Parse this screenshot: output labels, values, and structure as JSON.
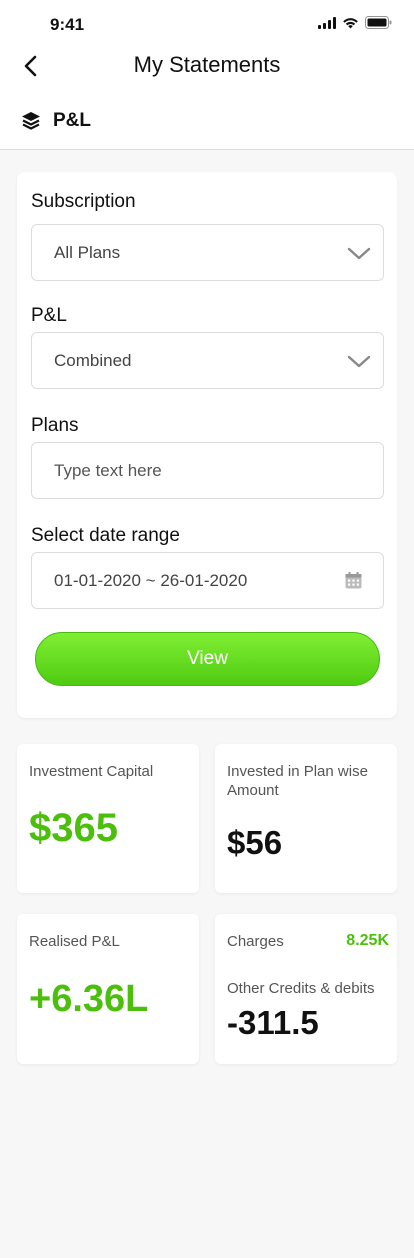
{
  "status_bar": {
    "time": "9:41"
  },
  "nav": {
    "title": "My Statements"
  },
  "section": {
    "title": "P&L"
  },
  "form": {
    "subscription": {
      "label": "Subscription",
      "value": "All Plans"
    },
    "pnl": {
      "label": "P&L",
      "value": "Combined"
    },
    "plans": {
      "label": "Plans",
      "placeholder": "Type text here"
    },
    "date_range": {
      "label": "Select date range",
      "value": "01-01-2020 ~ 26-01-2020"
    },
    "view_label": "View"
  },
  "stats": {
    "investment_capital": {
      "label": "Investment Capital",
      "value": "$365"
    },
    "invested_plan": {
      "label": "Invested in Plan wise Amount",
      "value": "$56"
    },
    "realised_pnl": {
      "label": "Realised P&L",
      "value": "+6.36L"
    },
    "charges": {
      "label": "Charges",
      "value": "8.25K"
    },
    "other_credits": {
      "label": "Other Credits & debits",
      "value": "-311.5"
    }
  },
  "colors": {
    "accent": "#4cbf0c",
    "button_top": "#80ef33",
    "button_bottom": "#4fcb12"
  },
  "icons": [
    "signal-icon",
    "wifi-icon",
    "battery-icon",
    "back-chevron-icon",
    "layers-icon",
    "chevron-down-icon",
    "calendar-icon"
  ]
}
